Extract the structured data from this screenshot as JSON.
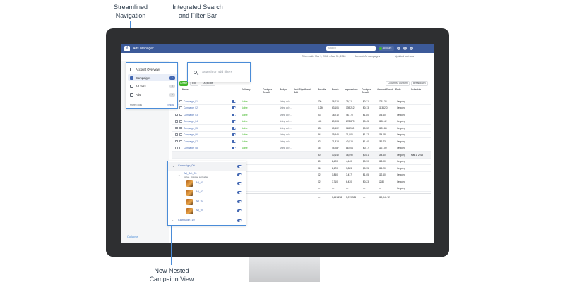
{
  "callouts": {
    "navigation": [
      "Streamlined",
      "Navigation"
    ],
    "search": [
      "Integrated Search",
      "and Filter Bar"
    ],
    "nested": [
      "New Nested",
      "Campaign View"
    ]
  },
  "app": {
    "name": "Ads Manager",
    "search_placeholder": "Search",
    "account": "Account",
    "date_range": "This month: Mar 1, 2018 – Mar 31, 2018",
    "scope": "Account: All campaigns",
    "last_updated": "Updated just now",
    "collapse": "Collapse"
  },
  "nav": {
    "items": [
      {
        "label": "Account Overview",
        "icon": "overview-icon",
        "badge": ""
      },
      {
        "label": "Campaigns",
        "icon": "folder-icon",
        "badge": "1"
      },
      {
        "label": "Ad Sets",
        "icon": "grid-icon",
        "badge": "0"
      },
      {
        "label": "Ads",
        "icon": "ad-icon",
        "badge": "0"
      }
    ],
    "more_tools": "More Tools",
    "show": "Show"
  },
  "search": {
    "placeholder": "Search or add filters"
  },
  "toolbar": {
    "create": "Create",
    "edit": "Edit",
    "duplicate": "Duplicate",
    "columns": "Columns: Custom",
    "breakdown": "Breakdown"
  },
  "table": {
    "headers": [
      "Name",
      "Delivery",
      "Cost per Result",
      "Budget",
      "Last Significant Edit",
      "Results",
      "Reach",
      "Impressions",
      "Cost per Result",
      "Amount Spent",
      "Ends",
      "Schedule"
    ],
    "rows": [
      {
        "name": "Campaign_01",
        "delivery": "Active",
        "budget": "Using ad s...",
        "results": "120",
        "reach": "16,010",
        "impr": "29,711",
        "cpr": "$0.21",
        "spent": "$291.33",
        "ends": "Ongoing"
      },
      {
        "name": "Campaign_02",
        "delivery": "Active",
        "budget": "Using ad s...",
        "results": "1,296",
        "reach": "63,106",
        "impr": "139,212",
        "cpr": "$0.13",
        "spent": "$1,362.01",
        "ends": "Ongoing"
      },
      {
        "name": "Campaign_03",
        "delivery": "Active",
        "budget": "Using ad s...",
        "results": "53",
        "reach": "38,210",
        "impr": "48,770",
        "cpr": "$1.80",
        "spent": "$95.60",
        "ends": "Ongoing"
      },
      {
        "name": "Campaign_04",
        "delivery": "Active",
        "budget": "Using ad s...",
        "results": "445",
        "reach": "29,904",
        "impr": "278,879",
        "cpr": "$0.45",
        "spent": "$198.42",
        "ends": "Ongoing"
      },
      {
        "name": "Campaign_05",
        "delivery": "Active",
        "budget": "Using ad s...",
        "results": "231",
        "reach": "60,402",
        "impr": "118,900",
        "cpr": "$0.52",
        "spent": "$120.88",
        "ends": "Ongoing"
      },
      {
        "name": "Campaign_06",
        "delivery": "Active",
        "budget": "Using ad s...",
        "results": "84",
        "reach": "19,440",
        "impr": "31,906",
        "cpr": "$1.12",
        "spent": "$94.08",
        "ends": "Ongoing"
      },
      {
        "name": "Campaign_07",
        "delivery": "Active",
        "budget": "Using ad s...",
        "results": "62",
        "reach": "21,318",
        "impr": "40,515",
        "cpr": "$1.40",
        "spent": "$86.73",
        "ends": "Ongoing"
      },
      {
        "name": "Campaign_08",
        "delivery": "Active",
        "budget": "Using ad s...",
        "results": "157",
        "reach": "44,287",
        "impr": "86,004",
        "cpr": "$0.77",
        "spent": "$121.00",
        "ends": "Ongoing"
      }
    ],
    "nested_rows": [
      {
        "results": "60",
        "reach": "10,140",
        "impr": "18,090",
        "cpr": "$0.81",
        "spent": "$48.60",
        "ends": "Ongoing",
        "schedule": "Mar 1, 2018"
      },
      {
        "results": "20",
        "reach": "2,420",
        "impr": "4,440",
        "cpr": "$0.90",
        "spent": "$18.00",
        "ends": "Ongoing"
      },
      {
        "results": "16",
        "reach": "2,170",
        "impr": "3,803",
        "cpr": "$0.95",
        "spent": "$15.20",
        "ends": "Ongoing"
      },
      {
        "results": "12",
        "reach": "1,840",
        "impr": "3,417",
        "cpr": "$1.05",
        "spent": "$12.60",
        "ends": "Ongoing"
      },
      {
        "results": "12",
        "reach": "3,710",
        "impr": "6,430",
        "cpr": "$0.23",
        "spent": "$2.80",
        "ends": "Ongoing"
      },
      {
        "results": "—",
        "reach": "—",
        "impr": "—",
        "cpr": "—",
        "spent": "—",
        "ends": "Ongoing"
      }
    ],
    "totals": {
      "results": "—",
      "reach": "1,451,298",
      "impr": "5,079,986",
      "cpr": "—",
      "spent": "$19,941.72"
    }
  },
  "nested": {
    "campaign": "Campaign_09",
    "adset": "Ad_Set_01",
    "adset_sub": "Active · Using ad set budget",
    "ads": [
      "Ad_01",
      "Ad_02",
      "Ad_03",
      "Ad_04"
    ],
    "next_campaign": "Campaign_10"
  }
}
